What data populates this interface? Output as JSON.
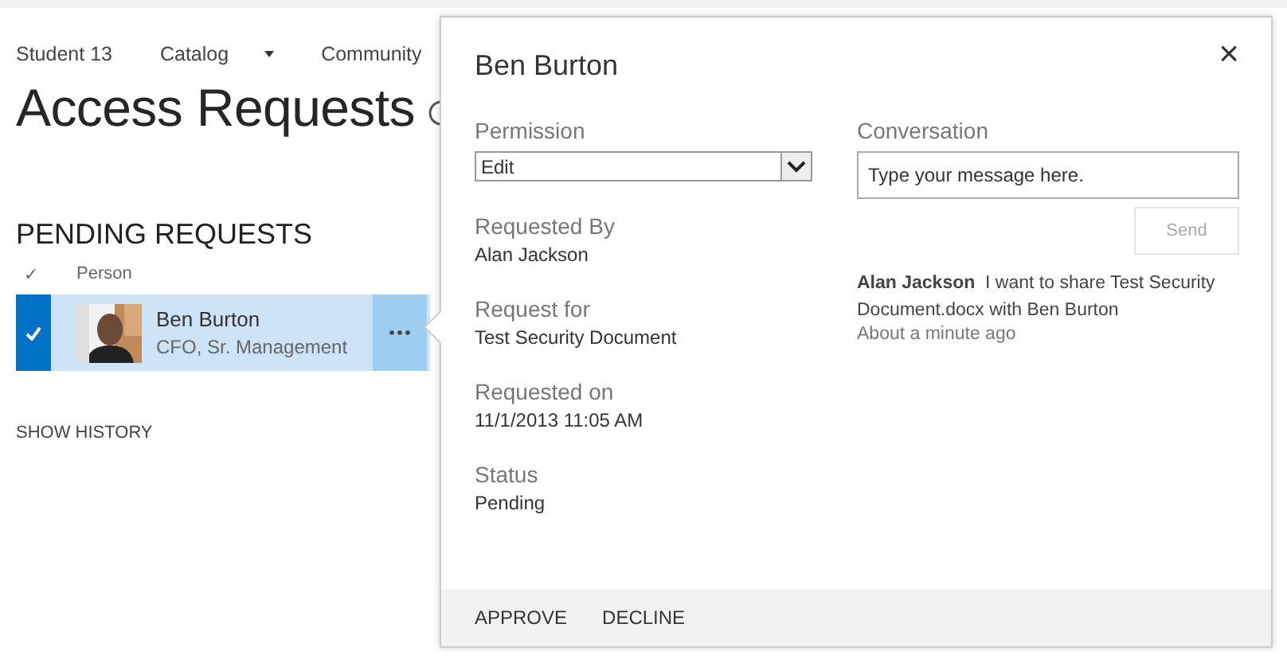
{
  "nav": [
    {
      "label": "Student 13",
      "dropdown": false
    },
    {
      "label": "Catalog",
      "dropdown": true
    },
    {
      "label": "Community",
      "dropdown": false
    }
  ],
  "title": "Access Requests",
  "section": "PENDING REQUESTS",
  "columns": [
    "✓",
    "Person"
  ],
  "rows": [
    {
      "name": "Ben Burton",
      "role": "CFO, Sr. Management",
      "selected": true
    }
  ],
  "show_history": "SHOW HISTORY",
  "panel": {
    "title": "Ben Burton",
    "close": "×",
    "permission": {
      "label": "Permission",
      "value": "Edit"
    },
    "details": [
      {
        "label": "Requested By",
        "value": "Alan Jackson"
      },
      {
        "label": "Request for",
        "value": "Test Security Document"
      },
      {
        "label": "Requested on",
        "value": "11/1/2013 11:05 AM"
      },
      {
        "label": "Status",
        "value": "Pending"
      }
    ],
    "conversation": {
      "label": "Conversation",
      "placeholder": "Type your message here.",
      "send": {
        "label": "Send",
        "disabled": true
      },
      "messages": [
        {
          "author": "Alan Jackson",
          "text": "I want to share Test Security Document.docx with Ben Burton",
          "time": "About a minute ago"
        }
      ]
    },
    "actions": [
      "APPROVE",
      "DECLINE"
    ]
  }
}
